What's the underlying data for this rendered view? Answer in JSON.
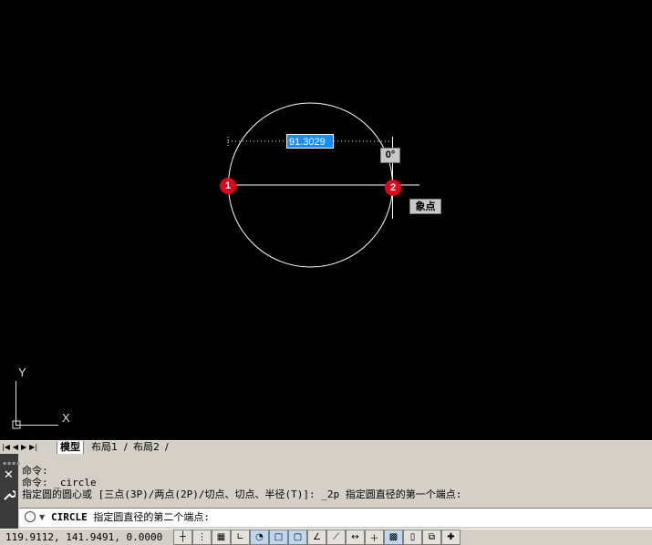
{
  "viewport": {
    "dimension_value": "91.3029",
    "angle_tooltip": "0°",
    "snap_tooltip": "象点",
    "marker_1": "1",
    "marker_2": "2",
    "ucs_y_label": "Y",
    "ucs_x_label": "X"
  },
  "tabs": {
    "model": "模型",
    "layout1": "布局1",
    "layout2": "布局2"
  },
  "command_history": [
    "命令:",
    "命令: _circle",
    "指定圆的圆心或 [三点(3P)/两点(2P)/切点、切点、半径(T)]: _2p 指定圆直径的第一个端点:"
  ],
  "command_input": {
    "command": "CIRCLE",
    "prompt": " 指定圆直径的第二个端点:"
  },
  "status": {
    "coordinates": "119.9112, 141.9491, 0.0000"
  },
  "colors": {
    "canvas": "#000000",
    "marker": "#e0001c",
    "dimension_input": "#1a8cff"
  }
}
